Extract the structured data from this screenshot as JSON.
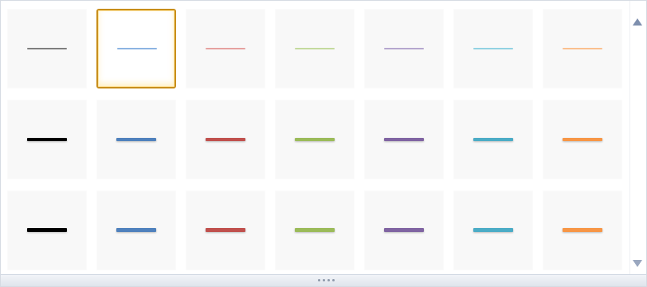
{
  "gallery": {
    "rows": [
      {
        "name": "thin",
        "items": [
          {
            "id": "thin-gray",
            "color": "#7f7f7f",
            "selected": false
          },
          {
            "id": "thin-blue",
            "color": "#8db4e2",
            "selected": true
          },
          {
            "id": "thin-red",
            "color": "#e6a2a0",
            "selected": false
          },
          {
            "id": "thin-green",
            "color": "#c4da9e",
            "selected": false
          },
          {
            "id": "thin-purple",
            "color": "#b5a7cf",
            "selected": false
          },
          {
            "id": "thin-aqua",
            "color": "#92d2e2",
            "selected": false
          },
          {
            "id": "thin-orange",
            "color": "#fbc08f",
            "selected": false
          }
        ]
      },
      {
        "name": "medium",
        "items": [
          {
            "id": "medium-black",
            "color": "#000000",
            "selected": false
          },
          {
            "id": "medium-blue",
            "color": "#4f81bd",
            "selected": false
          },
          {
            "id": "medium-red",
            "color": "#c0504d",
            "selected": false
          },
          {
            "id": "medium-green",
            "color": "#9bbb59",
            "selected": false
          },
          {
            "id": "medium-purple",
            "color": "#8064a2",
            "selected": false
          },
          {
            "id": "medium-aqua",
            "color": "#4bacc6",
            "selected": false
          },
          {
            "id": "medium-orange",
            "color": "#f79646",
            "selected": false
          }
        ]
      },
      {
        "name": "thick",
        "items": [
          {
            "id": "thick-black",
            "color": "#000000",
            "selected": false
          },
          {
            "id": "thick-blue",
            "color": "#4f81bd",
            "selected": false
          },
          {
            "id": "thick-red",
            "color": "#c0504d",
            "selected": false
          },
          {
            "id": "thick-green",
            "color": "#9bbb59",
            "selected": false
          },
          {
            "id": "thick-purple",
            "color": "#8064a2",
            "selected": false
          },
          {
            "id": "thick-aqua",
            "color": "#4bacc6",
            "selected": false
          },
          {
            "id": "thick-orange",
            "color": "#f79646",
            "selected": false
          }
        ]
      }
    ]
  },
  "scrollbar": {
    "up_icon": "scroll-up-arrow-icon",
    "down_icon": "scroll-down-arrow-icon"
  },
  "resize": {
    "grip_icon": "resize-grip-icon"
  }
}
